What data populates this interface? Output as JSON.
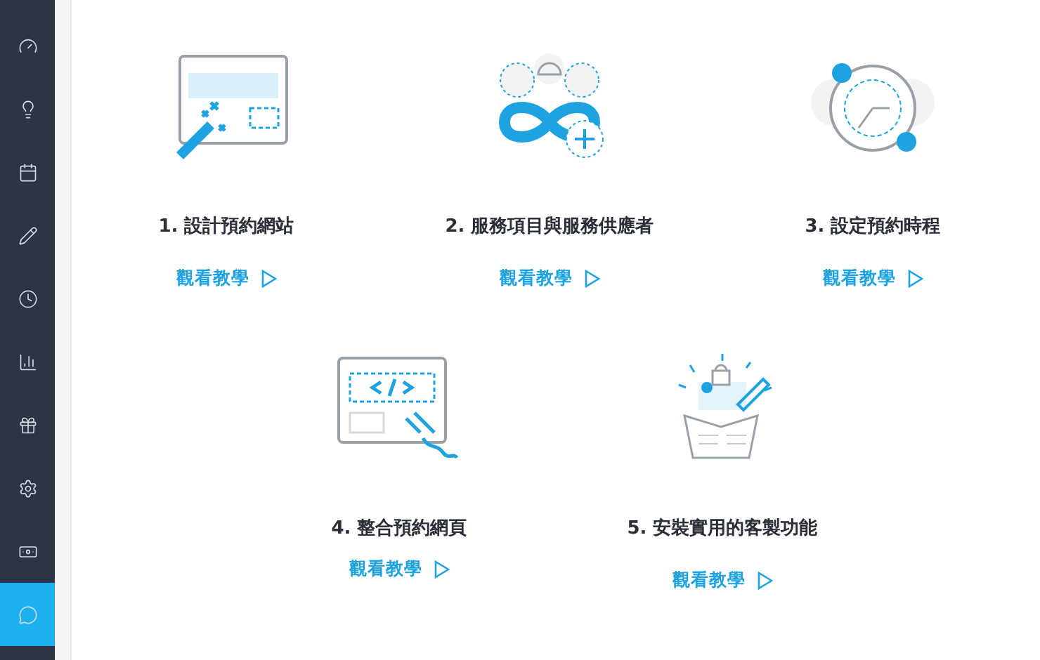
{
  "sidebar": {
    "items": [
      {
        "selected": false
      },
      {
        "selected": false
      },
      {
        "selected": false
      },
      {
        "selected": false
      },
      {
        "selected": false
      },
      {
        "selected": false
      },
      {
        "selected": false
      },
      {
        "selected": false
      },
      {
        "selected": false
      },
      {
        "selected": true
      }
    ]
  },
  "tutorial_rows": [
    [
      {
        "title": "1. 設計預約網站",
        "link": "觀看教學"
      },
      {
        "title": "2. 服務項目與服務供應者",
        "link": "觀看教學"
      },
      {
        "title": "3. 設定預約時程",
        "link": "觀看教學"
      }
    ],
    [
      {
        "title": "4. 整合預約網頁",
        "link": "觀看教學"
      },
      {
        "title": "5. 安裝實用的客製功能",
        "link": "觀看教學"
      }
    ]
  ]
}
